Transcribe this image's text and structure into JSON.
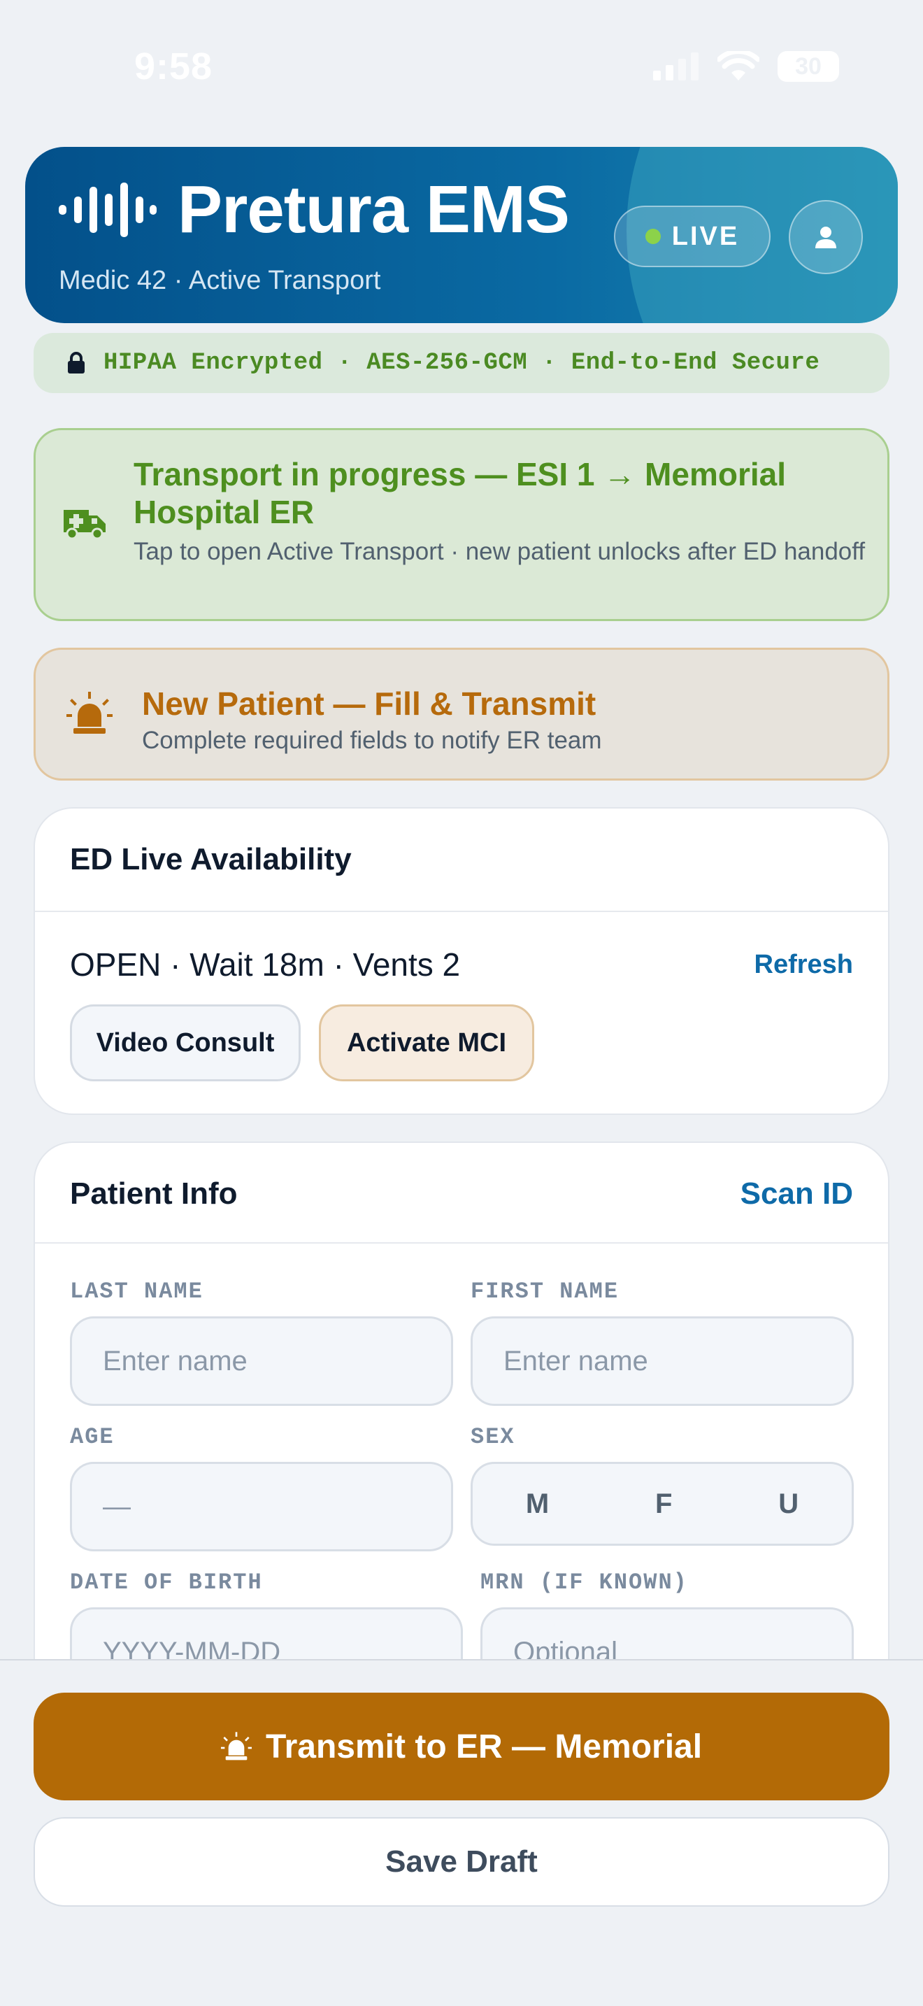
{
  "status_bar": {
    "time": "9:58",
    "battery": "30"
  },
  "header": {
    "title": "Pretura EMS",
    "subtitle": "Medic 42 · Active Transport",
    "live_label": "LIVE"
  },
  "security_banner": {
    "text": "HIPAA Encrypted · AES-256-GCM · End-to-End Secure"
  },
  "transport_banner": {
    "title": "Transport in progress — ESI 1 → Memorial Hospital ER",
    "subtitle": "Tap to open Active Transport · new patient unlocks after ED handoff"
  },
  "new_patient_banner": {
    "title": "New Patient — Fill & Transmit",
    "subtitle": "Complete required fields to notify ER team"
  },
  "ed_availability": {
    "title": "ED Live Availability",
    "status": "OPEN · Wait 18m · Vents 2",
    "refresh_label": "Refresh",
    "video_consult_label": "Video Consult",
    "activate_mci_label": "Activate MCI"
  },
  "patient_info": {
    "title": "Patient Info",
    "scan_label": "Scan ID",
    "last_name": {
      "label": "LAST NAME",
      "placeholder": "Enter name"
    },
    "first_name": {
      "label": "FIRST NAME",
      "placeholder": "Enter name"
    },
    "age": {
      "label": "AGE",
      "placeholder": "—"
    },
    "sex": {
      "label": "SEX",
      "options": [
        "M",
        "F",
        "U"
      ]
    },
    "dob": {
      "label": "DATE OF BIRTH",
      "placeholder": "YYYY-MM-DD"
    },
    "mrn": {
      "label": "MRN (IF KNOWN)",
      "placeholder": "Optional"
    }
  },
  "actions": {
    "transmit_label": "Transmit to ER — Memorial",
    "save_draft_label": "Save Draft"
  },
  "colors": {
    "brand_blue": "#03508a",
    "live_green": "#8cd24a",
    "transport_green": "#4e8f1f",
    "alert_orange": "#b66a0c",
    "transmit_orange": "#b36a06",
    "link_blue": "#0e6aa8"
  },
  "icons": {
    "brand": "waveform-icon",
    "profile": "user-icon",
    "security": "lock-icon",
    "transport": "ambulance-icon",
    "alert": "siren-icon"
  }
}
